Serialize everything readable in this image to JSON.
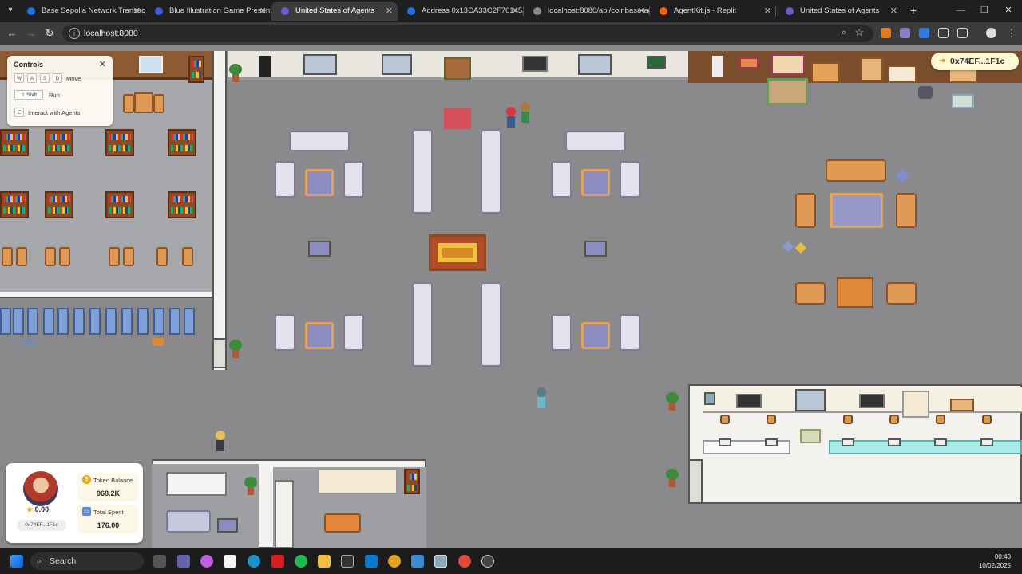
{
  "browser": {
    "tabs": [
      {
        "title": "Base Sepolia Network Transacti",
        "color": "#1a73e8"
      },
      {
        "title": "Blue Illustration Game Presenta",
        "color": "#3b5bdb"
      },
      {
        "title": "United States of Agents",
        "color": "#6a5acd"
      },
      {
        "title": "Address 0x13CA33C2F70145A0",
        "color": "#1a73e8"
      },
      {
        "title": "localhost:8080/api/coinbase-ag",
        "color": "#888888"
      },
      {
        "title": "AgentKit.js - Replit",
        "color": "#f26207"
      },
      {
        "title": "United States of Agents",
        "color": "#6a5acd"
      }
    ],
    "url": "localhost:8080"
  },
  "controls": {
    "title": "Controls",
    "keys": {
      "w": "W",
      "a": "A",
      "s": "S",
      "d": "D",
      "shift": "⇧ Shift",
      "e": "E"
    },
    "move_label": "Move",
    "run_label": "Run",
    "interact_label": "Interact with Agents"
  },
  "wallet": {
    "address": "0x74EF...1F1c"
  },
  "profile": {
    "score": "0.00",
    "address": "0x74EF...1F1c",
    "token_balance_label": "Token Balance",
    "token_balance_value": "968.2K",
    "total_spent_label": "Total Spent",
    "total_spent_value": "176.00"
  },
  "taskbar": {
    "search_label": "Search",
    "time": "00:40",
    "date": "10/02/2025"
  },
  "colors": {
    "accent": "#e8a41a",
    "floor": "#9d9fa3",
    "wood": "#e09a55"
  }
}
